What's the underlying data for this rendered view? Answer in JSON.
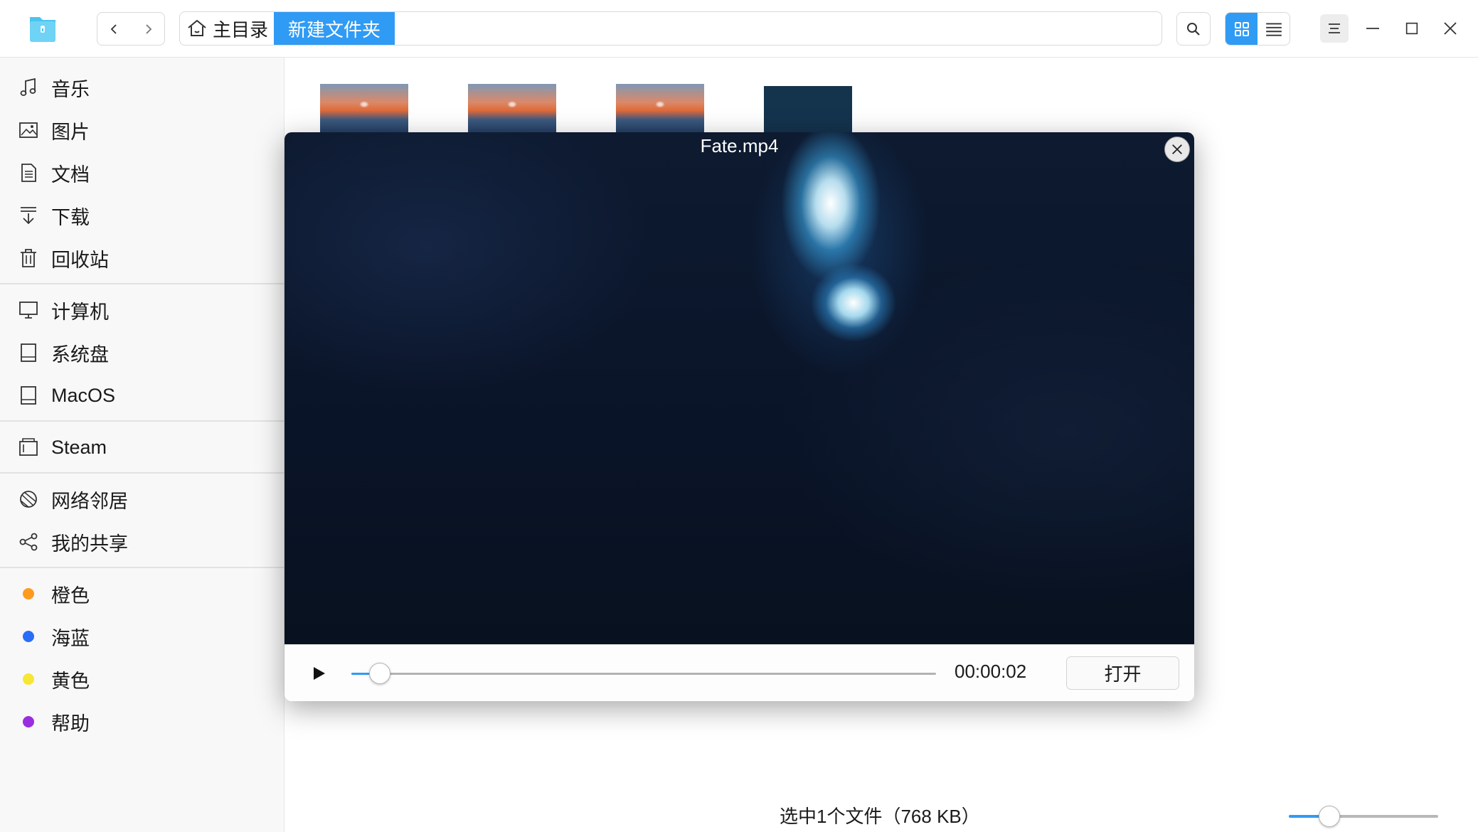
{
  "titlebar": {
    "app_icon": "file-manager-icon",
    "back_icon": "chevron-left-icon",
    "forward_icon": "chevron-right-icon",
    "breadcrumb": {
      "home_label": "主目录",
      "current_label": "新建文件夹"
    },
    "search_icon": "search-icon",
    "view_modes": [
      "grid-view-icon",
      "list-view-icon"
    ],
    "active_view": "grid",
    "window_controls": [
      "menu-icon",
      "minimize-icon",
      "maximize-icon",
      "close-icon"
    ]
  },
  "sidebar": {
    "groups": [
      [
        {
          "label": "音乐",
          "icon": "music-icon"
        },
        {
          "label": "图片",
          "icon": "image-icon"
        },
        {
          "label": "文档",
          "icon": "document-icon"
        },
        {
          "label": "下载",
          "icon": "download-icon"
        },
        {
          "label": "回收站",
          "icon": "trash-icon"
        }
      ],
      [
        {
          "label": "计算机",
          "icon": "computer-icon"
        },
        {
          "label": "系统盘",
          "icon": "disk-icon"
        },
        {
          "label": "MacOS",
          "icon": "disk-icon"
        }
      ],
      [
        {
          "label": "Steam",
          "icon": "removable-drive-icon"
        }
      ],
      [
        {
          "label": "网络邻居",
          "icon": "network-icon"
        },
        {
          "label": "我的共享",
          "icon": "share-icon"
        }
      ],
      [
        {
          "label": "橙色",
          "icon": "tag-dot-icon",
          "color": "#ff9a1f"
        },
        {
          "label": "海蓝",
          "icon": "tag-dot-icon",
          "color": "#2a6ef5"
        },
        {
          "label": "黄色",
          "icon": "tag-dot-icon",
          "color": "#f7e633"
        },
        {
          "label": "帮助",
          "icon": "tag-dot-icon",
          "color": "#9b2de0"
        }
      ]
    ]
  },
  "preview": {
    "filename": "Fate.mp4",
    "time": "00:00:02",
    "progress": 0.03,
    "open_label": "打开",
    "play_icon": "play-icon",
    "close_icon": "close-icon"
  },
  "statusbar": {
    "selection_text": "选中1个文件（768 KB）",
    "zoom_level": 0.27
  },
  "colors": {
    "accent": "#2f9bf4",
    "sidebar_bg": "#f8f8f8"
  }
}
